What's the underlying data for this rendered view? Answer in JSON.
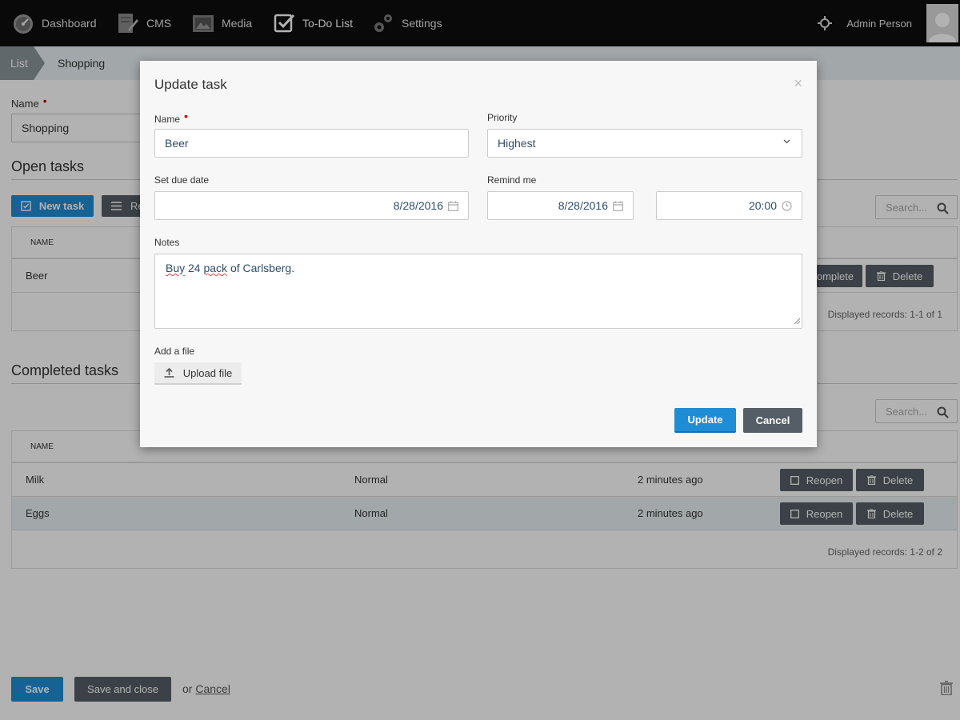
{
  "nav": {
    "items": [
      {
        "label": "Dashboard"
      },
      {
        "label": "CMS"
      },
      {
        "label": "Media"
      },
      {
        "label": "To-Do List"
      },
      {
        "label": "Settings"
      }
    ],
    "user_name": "Admin Person"
  },
  "breadcrumb": [
    "List",
    "Shopping"
  ],
  "form": {
    "name_label": "Name",
    "name_value": "Shopping"
  },
  "open_tasks": {
    "title": "Open tasks",
    "new_task_label": "New task",
    "reorder_label_partial": "Re",
    "search_placeholder": "Search...",
    "header": "NAME",
    "rows": [
      {
        "name": "Beer",
        "complete_label": "omplete",
        "delete_label": "Delete"
      }
    ],
    "footer": "Displayed records: 1-1 of 1"
  },
  "completed_tasks": {
    "title": "Completed tasks",
    "search_placeholder": "Search...",
    "headers": {
      "name": "NAME"
    },
    "rows": [
      {
        "name": "Milk",
        "priority": "Normal",
        "completed": "2 minutes ago",
        "reopen_label": "Reopen",
        "delete_label": "Delete"
      },
      {
        "name": "Eggs",
        "priority": "Normal",
        "completed": "2 minutes ago",
        "reopen_label": "Reopen",
        "delete_label": "Delete"
      }
    ],
    "footer": "Displayed records: 1-2 of 2"
  },
  "footer_actions": {
    "save": "Save",
    "save_close": "Save and close",
    "or": "or",
    "cancel": "Cancel"
  },
  "modal": {
    "title": "Update task",
    "close": "×",
    "name_label": "Name",
    "name_value": "Beer",
    "priority_label": "Priority",
    "priority_value": "Highest",
    "due_label": "Set due date",
    "due_value": "8/28/2016",
    "remind_label": "Remind me",
    "remind_date": "8/28/2016",
    "remind_time": "20:00",
    "notes_label": "Notes",
    "notes": {
      "w1": "Buy",
      "w2": " 24 ",
      "w3": "pack",
      "w4": " of Carlsberg."
    },
    "file_label": "Add a file",
    "upload_label": "Upload file",
    "update_label": "Update",
    "cancel_label": "Cancel"
  },
  "colors": {
    "primary": "#1f8dd6",
    "dark_button": "#555e66",
    "topbar": "#0d0d0d",
    "breadcrumb_bg": "#e9eff3",
    "required": "#cc0000"
  }
}
